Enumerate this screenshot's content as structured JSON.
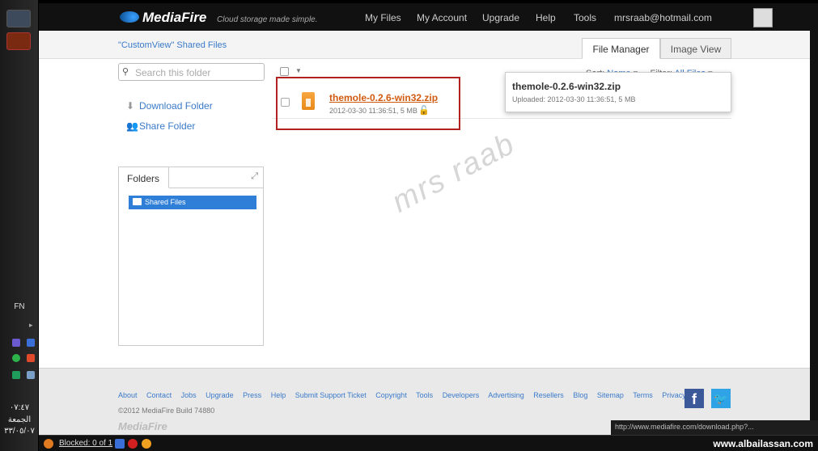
{
  "header": {
    "logo": "MediaFire",
    "tagline": "Cloud storage made simple.",
    "nav": [
      "My Files",
      "My Account",
      "Upgrade",
      "Help",
      "Tools"
    ],
    "email": "mrsraab@hotmail.com"
  },
  "sub": {
    "shared_title": "\"CustomView\" Shared Files",
    "tabs": [
      "File Manager",
      "Image View"
    ]
  },
  "toolbar": {
    "search_placeholder": "Search this folder",
    "sort_label": "Sort:",
    "sort_value": "Name",
    "filter_label": "Filter:",
    "filter_value": "All Files"
  },
  "actions": {
    "download": "Download Folder",
    "share": "Share Folder"
  },
  "file": {
    "name": "themole-0.2.6-win32.zip",
    "meta": "2012-03-30 11:36:51, 5 MB"
  },
  "tooltip": {
    "title": "themole-0.2.6-win32.zip",
    "meta": "Uploaded: 2012-03-30 11:36:51, 5 MB"
  },
  "folders": {
    "tab": "Folders",
    "item": "Shared Files"
  },
  "footer": {
    "links": [
      "About",
      "Contact",
      "Jobs",
      "Upgrade",
      "Press",
      "Help",
      "Submit Support Ticket",
      "Copyright",
      "Tools",
      "Developers",
      "Advertising",
      "Resellers",
      "Blog",
      "Sitemap",
      "Terms",
      "Privacy"
    ],
    "copyright": "©2012 MediaFire Build 74880",
    "logo": "MediaFire"
  },
  "status_url": "http://www.mediafire.com/download.php?...",
  "taskbar": {
    "lang": "FN",
    "time": "٠٧:٤٧",
    "day": "الجمعة",
    "date": "٣٣/٠٥/٠٧",
    "blocked": "Blocked: 0 of 1",
    "site": "www.albailassan.com"
  },
  "watermark": "mrs raab",
  "colors": {
    "header_bg": "#111111",
    "link": "#3a7ac9",
    "file_link": "#d05a10",
    "folder_selected": "#2f7fd8",
    "highlight_box": "#b22222"
  }
}
